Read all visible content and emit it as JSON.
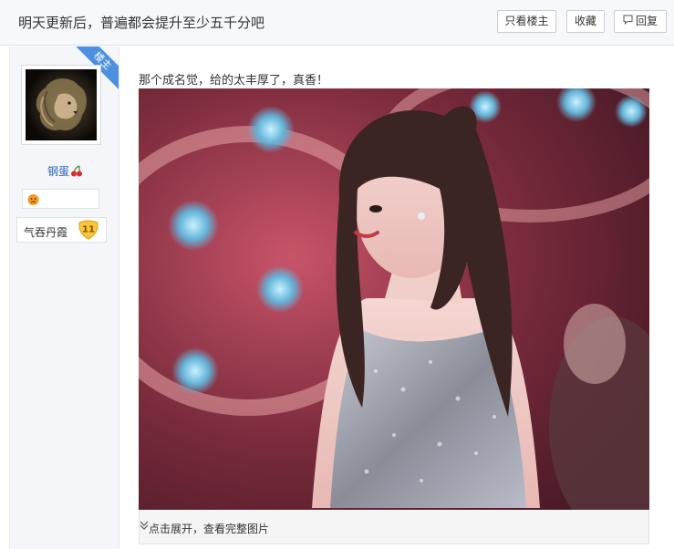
{
  "header": {
    "thread_title": "明天更新后，普遍都会提升至少五千分吧",
    "only_op_label": "只看楼主",
    "favorite_label": "收藏",
    "reply_label": "回复",
    "reply_icon": "comment-icon"
  },
  "author": {
    "op_ribbon": "楼主",
    "avatar_icon": "lion-avatar",
    "username": "钢蛋",
    "username_icon": "cherry-icon",
    "badge_icon": "emoji-badge-icon",
    "level_name": "气吞丹霞",
    "level_number": "11"
  },
  "post": {
    "text": "那个成名觉，给的太丰厚了，真香！",
    "image_icon": "photo-of-performer-in-sequin-dress",
    "expand_label": "点击展开，查看完整图片",
    "expand_icon": "double-chevron-down-icon"
  },
  "colors": {
    "header_bg": "#f7f8fa",
    "sidebar_bg": "#f4f6f9",
    "ribbon": "#4d8fe1",
    "username": "#2d64b3",
    "level_badge": "#f3c22b"
  }
}
